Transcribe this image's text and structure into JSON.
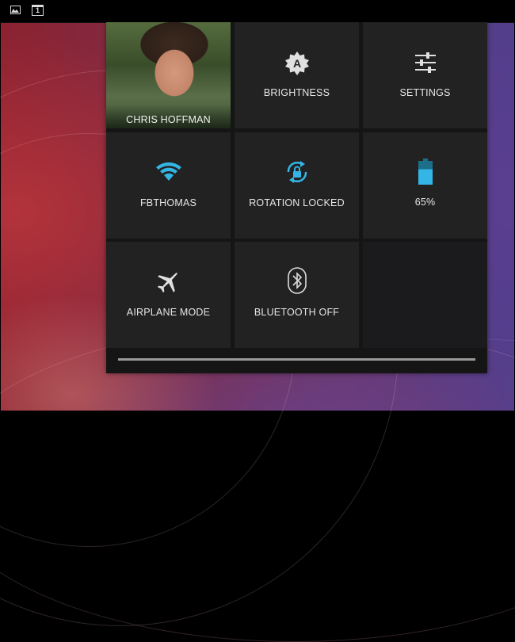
{
  "status_bar": {
    "icons": [
      "gallery-icon",
      "notification-count-icon"
    ],
    "notification_count": "1"
  },
  "quick_settings": {
    "profile": {
      "name": "CHRIS HOFFMAN"
    },
    "tiles": {
      "brightness": {
        "label": "BRIGHTNESS",
        "icon": "brightness-auto-icon",
        "icon_letter": "A"
      },
      "settings": {
        "label": "SETTINGS",
        "icon": "sliders-icon"
      },
      "wifi": {
        "label": "FBTHOMAS",
        "icon": "wifi-icon"
      },
      "rotation": {
        "label": "ROTATION LOCKED",
        "icon": "rotation-lock-icon"
      },
      "battery": {
        "label": "65%",
        "icon": "battery-icon",
        "level_percent": 65
      },
      "airplane": {
        "label": "AIRPLANE MODE",
        "icon": "airplane-icon"
      },
      "bluetooth": {
        "label": "BLUETOOTH OFF",
        "icon": "bluetooth-icon"
      }
    },
    "progress_fraction": 1.0
  },
  "colors": {
    "accent": "#33b5e5",
    "tile_bg": "#222222",
    "panel_bg": "#151515",
    "label": "#e6e6e6"
  }
}
